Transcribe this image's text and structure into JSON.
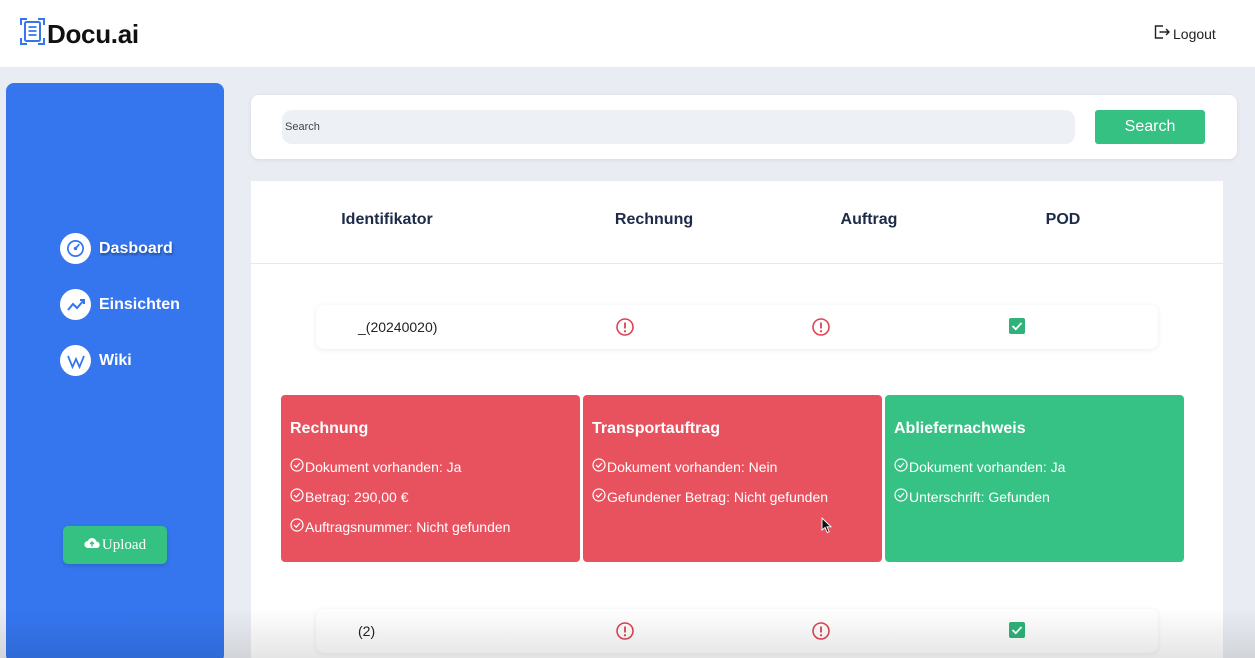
{
  "app": {
    "title": "Docu.ai"
  },
  "header": {
    "logout_label": "Logout"
  },
  "sidebar": {
    "items": [
      {
        "label": "Dasboard",
        "icon": "gauge-icon"
      },
      {
        "label": "Einsichten",
        "icon": "trend-chart-icon"
      },
      {
        "label": "Wiki",
        "icon": "wikipedia-icon"
      }
    ],
    "upload_label": "Upload"
  },
  "search": {
    "placeholder": "Search",
    "value": "",
    "button_label": "Search"
  },
  "table": {
    "columns": [
      "Identifikator",
      "Rechnung",
      "Auftrag",
      "POD"
    ],
    "rows": [
      {
        "id": "_(20240020)",
        "rechnung": "warning-icon",
        "auftrag": "warning-icon",
        "pod": "checkbox-checked-icon"
      },
      {
        "id": "(2)",
        "rechnung": "warning-icon",
        "auftrag": "warning-icon",
        "pod": "checkbox-checked-icon"
      }
    ]
  },
  "details": [
    {
      "title": "Rechnung",
      "status": "error",
      "lines": [
        "Dokument vorhanden: Ja",
        "Betrag: 290,00 €",
        "Auftragsnummer: Nicht gefunden"
      ]
    },
    {
      "title": "Transportauftrag",
      "status": "error",
      "lines": [
        "Dokument vorhanden: Nein",
        "Gefundener Betrag: Nicht gefunden"
      ]
    },
    {
      "title": "Abliefernachweis",
      "status": "ok",
      "lines": [
        "Dokument vorhanden: Ja",
        "Unterschrift: Gefunden"
      ]
    }
  ],
  "colors": {
    "sidebar": "#3576ef",
    "accent_green": "#34c182",
    "error_red": "#e8525f",
    "warning_icon_red": "#e04152",
    "check_green": "#2fb37a"
  }
}
